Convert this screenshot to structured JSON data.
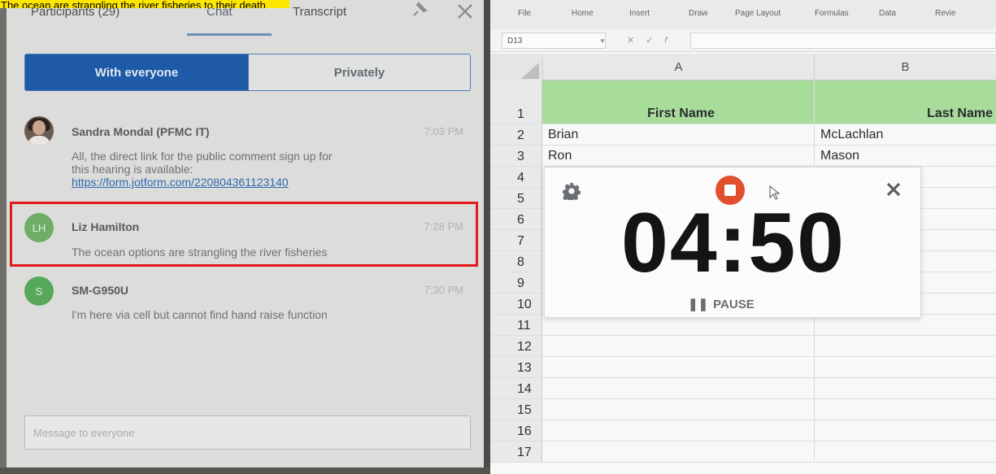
{
  "caption": "The ocean are strangling the river fisheries to their death",
  "chat": {
    "tabs": [
      {
        "label": "Participants (29)"
      },
      {
        "label": "Chat"
      },
      {
        "label": "Transcript"
      }
    ],
    "segment": {
      "everyone": "With everyone",
      "privately": "Privately"
    },
    "messages": [
      {
        "sender": "Sandra Mondal (PFMC IT)",
        "time": "7:03 PM",
        "text_line1": "All, the direct link for the public comment sign up for",
        "text_line2": "this hearing is available:",
        "link": "https://form.jotform.com/220804361123140"
      },
      {
        "initials": "LH",
        "sender": "Liz Hamilton",
        "time": "7:28 PM",
        "text": "The ocean options are strangling the river fisheries"
      },
      {
        "initials": "S",
        "sender": "SM-G950U",
        "time": "7:30 PM",
        "text": "I'm here via cell but cannot find hand raise function"
      }
    ],
    "input_placeholder": "Message to everyone"
  },
  "sheet": {
    "ribbon": [
      "File",
      "Home",
      "Insert",
      "Draw",
      "Page Layout",
      "Formulas",
      "Data",
      "Revie"
    ],
    "namebox": "D13",
    "columns": [
      "A",
      "B"
    ],
    "headers": {
      "a": "First Name",
      "b": "Last Name"
    },
    "rows": [
      {
        "num": "1"
      },
      {
        "num": "2",
        "a": "Brian",
        "b": "McLachlan"
      },
      {
        "num": "3",
        "a": "Ron",
        "b": "Mason"
      },
      {
        "num": "4"
      },
      {
        "num": "5"
      },
      {
        "num": "6"
      },
      {
        "num": "7"
      },
      {
        "num": "8"
      },
      {
        "num": "9"
      },
      {
        "num": "10"
      },
      {
        "num": "11"
      },
      {
        "num": "12"
      },
      {
        "num": "13"
      },
      {
        "num": "14"
      },
      {
        "num": "15"
      },
      {
        "num": "16"
      },
      {
        "num": "17"
      }
    ]
  },
  "timer": {
    "time": "04:50",
    "pause_label": "PAUSE",
    "stop_color": "#e0502e"
  }
}
